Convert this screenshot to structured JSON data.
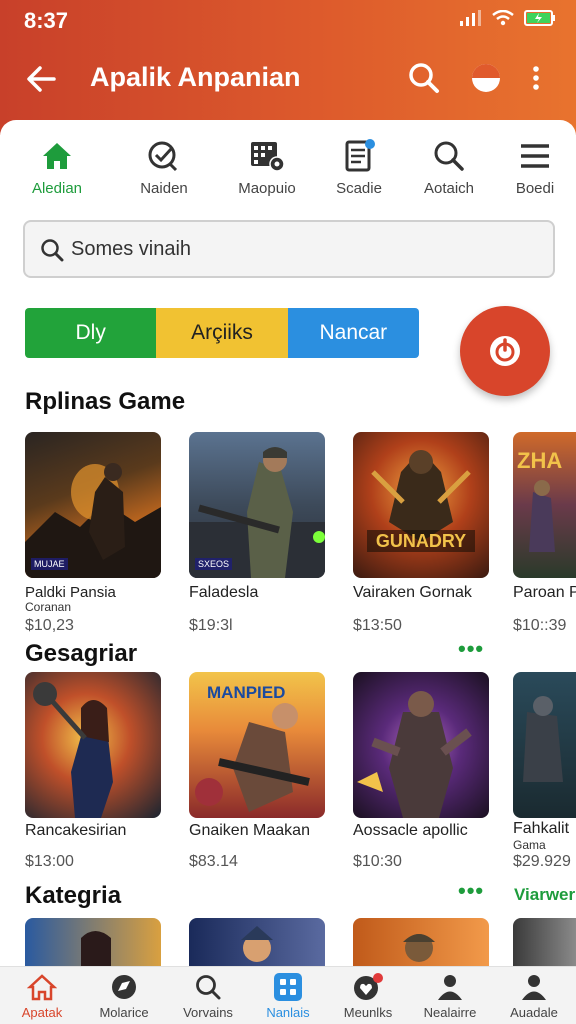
{
  "status": {
    "time": "8:37"
  },
  "appbar": {
    "title": "Apalik Anpanian"
  },
  "topnav": [
    {
      "label": "Aledian",
      "icon": "home-icon"
    },
    {
      "label": "Naiden",
      "icon": "clock-check-icon"
    },
    {
      "label": "Maopuio",
      "icon": "grid-gear-icon"
    },
    {
      "label": "Scadie",
      "icon": "document-icon"
    },
    {
      "label": "Aotaich",
      "icon": "search-icon"
    },
    {
      "label": "Boedi",
      "icon": "menu-icon"
    }
  ],
  "search": {
    "placeholder": "Somes vinaih"
  },
  "segments": [
    "Dly",
    "Arçiiks",
    "Nancar"
  ],
  "sections": {
    "s1": {
      "title": "Rplinas Game"
    },
    "s2": {
      "title": "Gesagriar"
    },
    "s3": {
      "title": "Kategria",
      "link": "Viarwer"
    }
  },
  "row1": [
    {
      "name": "Paldki Pansia",
      "sub": "Coranan",
      "price": "$10,23",
      "badge": "MUJAE"
    },
    {
      "name": "Faladesla",
      "price": "$19:3l",
      "badge": "SXEOS"
    },
    {
      "name": "Vairaken Gornak",
      "price": "$13:50",
      "badge": "GUNADRY"
    },
    {
      "name": "Paroan P",
      "price": "$10::39"
    }
  ],
  "row2": [
    {
      "name": "Rancakesirian",
      "price": "$13:00"
    },
    {
      "name": "Gnaiken Maakan",
      "price": "$83.14"
    },
    {
      "name": "Aossacle apollic",
      "price": "$10:30"
    },
    {
      "name": "Fahkalit",
      "sub": "Gama",
      "price": "$29.929"
    }
  ],
  "bottomnav": [
    {
      "label": "Apatak",
      "icon": "home-icon"
    },
    {
      "label": "Molarice",
      "icon": "compass-icon"
    },
    {
      "label": "Vorvains",
      "icon": "search-icon"
    },
    {
      "label": "Nanlais",
      "icon": "apps-icon"
    },
    {
      "label": "Meunlks",
      "icon": "heart-icon"
    },
    {
      "label": "Nealairre",
      "icon": "person-icon"
    },
    {
      "label": "Auadale",
      "icon": "account-icon"
    }
  ],
  "colors": {
    "accent": "#d8452b",
    "green": "#1e9c3c",
    "blue": "#2b8fe0",
    "yellow": "#f1c232"
  }
}
